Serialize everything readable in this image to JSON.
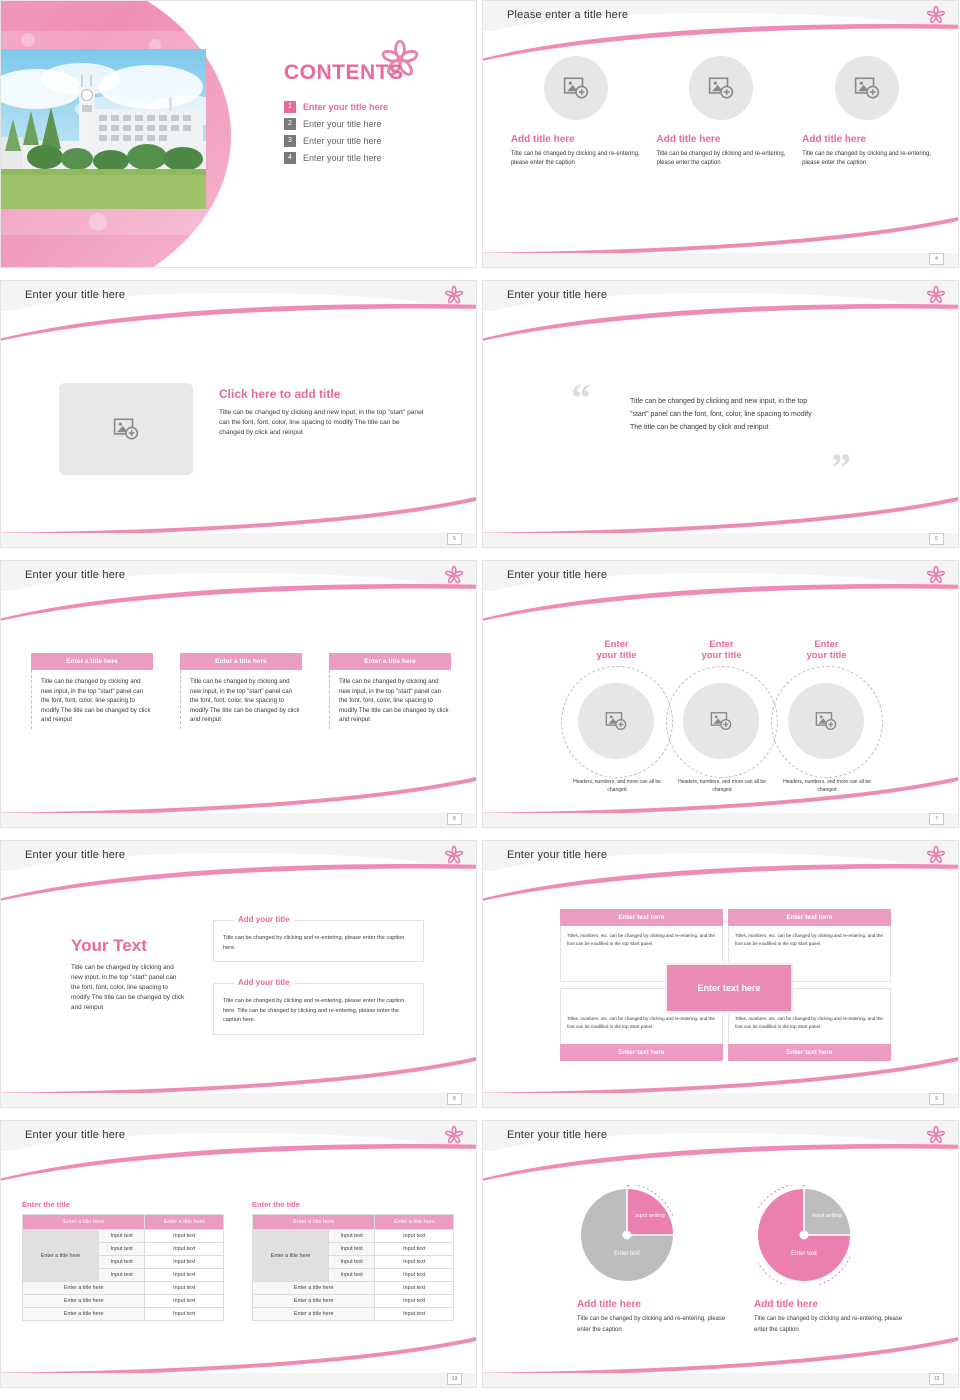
{
  "theme": {
    "pink": "#e8699b",
    "pink_light": "#eb9cc0",
    "pink_pale": "#f3a7c4",
    "gray": "#e6e6e6",
    "header_bg": "#f4f4f4"
  },
  "slides": [
    {
      "id": "cover-contents",
      "heading": "CONTENTS",
      "toc": [
        {
          "num": "1",
          "label": "Enter your title here"
        },
        {
          "num": "2",
          "label": "Enter your title here"
        },
        {
          "num": "3",
          "label": "Enter your title here"
        },
        {
          "num": "4",
          "label": "Enter your title here"
        }
      ]
    },
    {
      "id": "three-circles",
      "title": "Please enter a title here",
      "page": "4",
      "cards": [
        {
          "title": "Add title here",
          "body": "Title can be changed by clicking and re-entering, please enter the caption"
        },
        {
          "title": "Add title here",
          "body": "Title can be changed by clicking and re-entering, please enter the caption"
        },
        {
          "title": "Add title here",
          "body": "Title can be changed by clicking and re-entering, please enter the caption"
        }
      ]
    },
    {
      "id": "image-and-text",
      "title": "Enter your title here",
      "page": "5",
      "content_title": "Click here to add title",
      "content_body": "Title can be changed by clicking and new input, in the top \"start\" panel can the font, font, color, line spacing to modify The title can be changed by click and reinput"
    },
    {
      "id": "quote",
      "title": "Enter your title here",
      "page": "6",
      "quote": "Title can be changed by clicking and new input, in the top \"start\" panel can the font, font, color, line spacing to modify The title can be changed by click and reinput",
      "quote_open": "“",
      "quote_close": "”"
    },
    {
      "id": "three-columns",
      "title": "Enter your title here",
      "page": "8",
      "columns": [
        {
          "header": "Enter a title here",
          "body": "Title can be changed by clicking and new input, in the top \"start\" panel can the font, font, color, line spacing to modify The title can be changed by click and reinput"
        },
        {
          "header": "Enter a title here",
          "body": "Title can be changed by clicking and new input, in the top \"start\" panel can the font, font, color, line spacing to modify The title can be changed by click and reinput"
        },
        {
          "header": "Enter a title here",
          "body": "Title can be changed by clicking and new input, in the top \"start\" panel can the font, font, color, line spacing to modify The title can be changed by click and reinput"
        }
      ]
    },
    {
      "id": "three-overlap-circles",
      "title": "Enter your title here",
      "page": "7",
      "items": [
        {
          "title_line1": "Enter",
          "title_line2": "your title",
          "caption": "Headers, numbers, and more can all be changed"
        },
        {
          "title_line1": "Enter",
          "title_line2": "your title",
          "caption": "Headers, numbers, and more can all be changed"
        },
        {
          "title_line1": "Enter",
          "title_line2": "your title",
          "caption": "Headers, numbers, and more can all be changed"
        }
      ]
    },
    {
      "id": "your-text",
      "title": "Enter your title here",
      "page": "8",
      "big_title": "Your Text",
      "big_body": "Title can be changed by clicking and new input, in the top \"start\" panel can the font, font, color, line spacing to modify The title can be changed by click and reinput",
      "boxes": [
        {
          "title": "Add your title",
          "body": "Title can be changed by clicking and re-entering, please enter the caption here."
        },
        {
          "title": "Add your title",
          "body": "Title can be changed by clicking and re-entering, please enter the caption here. Title can be changed by clicking and re-entering, please enter the caption here."
        }
      ]
    },
    {
      "id": "four-quadrant",
      "title": "Enter your title here",
      "page": "9",
      "center_label": "Enter text here",
      "quadrants": [
        {
          "header": "Enter text here",
          "body": "Titles, numbers, etc. can be changed by clicking and re-entering, and the font can be modified in the top Start panel."
        },
        {
          "header": "Enter text here",
          "body": "Titles, numbers, etc. can be changed by clicking and re-entering, and the font can be modified in the top Start panel."
        },
        {
          "header": "Enter text here",
          "body": "Titles, numbers, etc. can be changed by clicking and re-entering, and the font can be modified in the top Start panel."
        },
        {
          "header": "Enter text here",
          "body": "Titles, numbers, etc. can be changed by clicking and re-entering, and the font can be modified in the top Start panel."
        }
      ]
    },
    {
      "id": "tables",
      "title": "Enter your title here",
      "page": "13",
      "tables": [
        {
          "caption": "Enter the title",
          "headers": [
            "Enter a title here",
            "Enter a title here"
          ],
          "row_header": "Enter a title here",
          "grouped_rows": [
            [
              "Input text",
              "Input text"
            ],
            [
              "Input text",
              "Input text"
            ],
            [
              "Input text",
              "Input text"
            ],
            [
              "Input text",
              "Input text"
            ]
          ],
          "footer_rows": [
            [
              "Enter a title here",
              "Input text"
            ],
            [
              "Enter a title here",
              "Input text"
            ],
            [
              "Enter a title here",
              "Input text"
            ]
          ]
        },
        {
          "caption": "Enter the title",
          "headers": [
            "Enter a title here",
            "Enter a title here"
          ],
          "row_header": "Enter a title here",
          "grouped_rows": [
            [
              "Input text",
              "Input text"
            ],
            [
              "Input text",
              "Input text"
            ],
            [
              "Input text",
              "Input text"
            ],
            [
              "Input text",
              "Input text"
            ]
          ],
          "footer_rows": [
            [
              "Enter a title here",
              "Input text"
            ],
            [
              "Enter a title here",
              "Input text"
            ],
            [
              "Enter a title here",
              "Input text"
            ]
          ]
        }
      ]
    },
    {
      "id": "donut-charts",
      "title": "Enter your title here",
      "page": "15",
      "charts": [
        {
          "slice_label": "input writing",
          "base_label": "Enter text",
          "title": "Add title here",
          "body": "Title can be changed by clicking and re-entering, please enter the caption",
          "pink_percent": 25
        },
        {
          "slice_label": "input writing",
          "base_label": "Enter text",
          "title": "Add title here",
          "body": "Title can be changed by clicking and re-entering, please enter the caption",
          "pink_percent": 75
        }
      ]
    }
  ]
}
